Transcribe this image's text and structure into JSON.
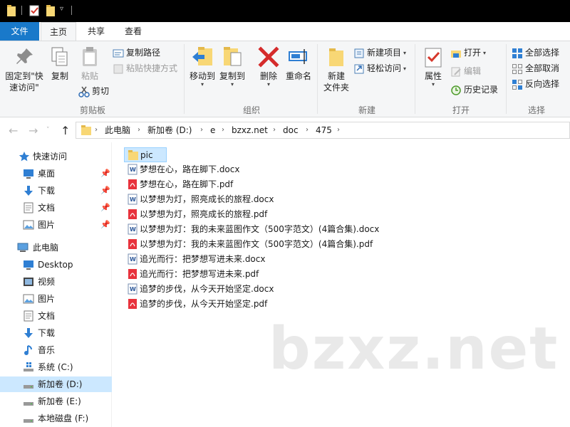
{
  "ribbon_tabs": [
    "文件",
    "主页",
    "共享",
    "查看"
  ],
  "ribbon": {
    "clipboard": {
      "pin_quick_access": "固定到\"快速访问\"",
      "copy": "复制",
      "paste": "粘贴",
      "copy_path": "复制路径",
      "paste_shortcut": "粘贴快捷方式",
      "cut": "剪切",
      "group_label": "剪贴板"
    },
    "organize": {
      "move_to": "移动到",
      "copy_to": "复制到",
      "delete": "删除",
      "rename": "重命名",
      "group_label": "组织"
    },
    "new": {
      "new_folder": "新建\n文件夹",
      "new_item": "新建项目",
      "easy_access": "轻松访问",
      "group_label": "新建"
    },
    "open": {
      "properties": "属性",
      "open": "打开",
      "edit": "编辑",
      "history": "历史记录",
      "group_label": "打开"
    },
    "select": {
      "select_all": "全部选择",
      "select_none": "全部取消",
      "invert": "反向选择",
      "group_label": "选择"
    }
  },
  "breadcrumb": [
    "此电脑",
    "新加卷 (D:)",
    "e",
    "bzxz.net",
    "doc",
    "475"
  ],
  "sidebar": {
    "quick_access": "快速访问",
    "quick_items": [
      "桌面",
      "下载",
      "文档",
      "图片"
    ],
    "this_pc": "此电脑",
    "pc_items": [
      "Desktop",
      "视频",
      "图片",
      "文档",
      "下载",
      "音乐",
      "系统 (C:)",
      "新加卷 (D:)",
      "新加卷 (E:)",
      "本地磁盘 (F:)"
    ]
  },
  "files": [
    {
      "name": "pic",
      "type": "folder"
    },
    {
      "name": "梦想在心，路在脚下.docx",
      "type": "docx"
    },
    {
      "name": "梦想在心，路在脚下.pdf",
      "type": "pdf"
    },
    {
      "name": "以梦想为灯，照亮成长的旅程.docx",
      "type": "docx"
    },
    {
      "name": "以梦想为灯，照亮成长的旅程.pdf",
      "type": "pdf"
    },
    {
      "name": "以梦想为灯：我的未来蓝图作文（500字范文）(4篇合集).docx",
      "type": "docx"
    },
    {
      "name": "以梦想为灯：我的未来蓝图作文（500字范文）(4篇合集).pdf",
      "type": "pdf"
    },
    {
      "name": "追光而行：把梦想写进未来.docx",
      "type": "docx"
    },
    {
      "name": "追光而行：把梦想写进未来.pdf",
      "type": "pdf"
    },
    {
      "name": "追梦的步伐，从今天开始坚定.docx",
      "type": "docx"
    },
    {
      "name": "追梦的步伐，从今天开始坚定.pdf",
      "type": "pdf"
    }
  ],
  "watermark": "bzxz.net",
  "colors": {
    "accent": "#1979ca",
    "selection": "#cce8ff",
    "folder": "#f8d775",
    "pdf": "#e8323c",
    "docx": "#2b579a"
  }
}
